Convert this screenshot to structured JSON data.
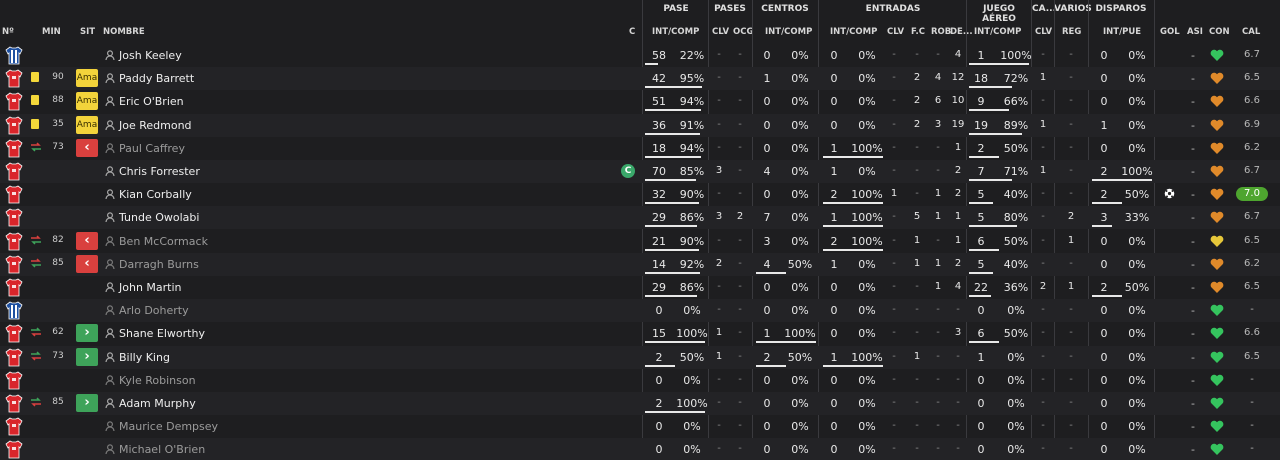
{
  "groups": {
    "pase": "PASE",
    "pases": "PASES",
    "centros": "CENTROS",
    "entradas": "ENTRADAS",
    "juego_aereo": "JUEGO AÉREO",
    "ca": "CA...",
    "varios": "VARIOS",
    "disparos": "DISPAROS"
  },
  "columns": {
    "num": "Nº",
    "min": "MIN",
    "sit": "SIT",
    "nombre": "NOMBRE",
    "c": "C",
    "pase_ic": "INT/COMP",
    "pases_clv": "CLV",
    "pases_ocg": "OCG",
    "centros_ic": "INT/COMP",
    "entradas_ic": "INT/COMP",
    "entradas_clv": "CLV",
    "entradas_fc": "F.C",
    "entradas_rob": "ROB",
    "entradas_de": "DE...",
    "aereo_ic": "INT/COMP",
    "ca_clv": "CLV",
    "varios_reg": "REG",
    "disparos_ip": "INT/PUE",
    "gol": "GOL",
    "asi": "ASI",
    "con": "CON",
    "cal": "CAL"
  },
  "captain_badge": "C",
  "colors": {
    "kit_red": "#d9252b",
    "kit_blue": "#1d4fa0",
    "card_yellow": "#f4d83a",
    "sub_out": "#d9403e",
    "sub_in": "#3ea35a",
    "heart_green": "#35c45e",
    "heart_orange": "#e08a2a",
    "heart_yellow": "#e6c73a",
    "best_rating": "#4ea52f"
  },
  "players": [
    {
      "kit": "gk",
      "evt": "",
      "min": "",
      "sit": "",
      "name": "Josh Keeley",
      "dim": false,
      "captain": false,
      "pase": [
        "58",
        "22%"
      ],
      "pase_bar": 0.22,
      "pclv": "-",
      "pocg": "-",
      "cen": [
        "0",
        "0%"
      ],
      "cen_bar": 0,
      "ent": [
        "0",
        "0%"
      ],
      "ent_bar": 0,
      "eclv": "-",
      "efc": "-",
      "erob": "-",
      "ede": "4",
      "aer": [
        "1",
        "100%"
      ],
      "aer_bar": 1,
      "caclv": "-",
      "reg": "-",
      "dis": [
        "0",
        "0%"
      ],
      "dis_bar": 0,
      "gol": "",
      "asi": "-",
      "con": "green",
      "cal": "6.7",
      "best": false
    },
    {
      "kit": "out",
      "evt": "card",
      "min": "90",
      "sit": "Ama",
      "name": "Paddy Barrett",
      "dim": false,
      "captain": false,
      "pase": [
        "42",
        "95%"
      ],
      "pase_bar": 0.95,
      "pclv": "-",
      "pocg": "-",
      "cen": [
        "1",
        "0%"
      ],
      "cen_bar": 0,
      "ent": [
        "0",
        "0%"
      ],
      "ent_bar": 0,
      "eclv": "-",
      "efc": "2",
      "erob": "4",
      "ede": "12",
      "aer": [
        "18",
        "72%"
      ],
      "aer_bar": 0.72,
      "caclv": "1",
      "reg": "-",
      "dis": [
        "0",
        "0%"
      ],
      "dis_bar": 0,
      "gol": "",
      "asi": "-",
      "con": "orange",
      "cal": "6.5",
      "best": false
    },
    {
      "kit": "out",
      "evt": "card",
      "min": "88",
      "sit": "Ama",
      "name": "Eric O'Brien",
      "dim": false,
      "captain": false,
      "pase": [
        "51",
        "94%"
      ],
      "pase_bar": 0.94,
      "pclv": "-",
      "pocg": "-",
      "cen": [
        "0",
        "0%"
      ],
      "cen_bar": 0,
      "ent": [
        "0",
        "0%"
      ],
      "ent_bar": 0,
      "eclv": "-",
      "efc": "2",
      "erob": "6",
      "ede": "10",
      "aer": [
        "9",
        "66%"
      ],
      "aer_bar": 0.66,
      "caclv": "-",
      "reg": "-",
      "dis": [
        "0",
        "0%"
      ],
      "dis_bar": 0,
      "gol": "",
      "asi": "-",
      "con": "orange",
      "cal": "6.6",
      "best": false
    },
    {
      "kit": "out",
      "evt": "card",
      "min": "35",
      "sit": "Ama",
      "name": "Joe Redmond",
      "dim": false,
      "captain": false,
      "pase": [
        "36",
        "91%"
      ],
      "pase_bar": 0.91,
      "pclv": "-",
      "pocg": "-",
      "cen": [
        "0",
        "0%"
      ],
      "cen_bar": 0,
      "ent": [
        "0",
        "0%"
      ],
      "ent_bar": 0,
      "eclv": "-",
      "efc": "2",
      "erob": "3",
      "ede": "19",
      "aer": [
        "19",
        "89%"
      ],
      "aer_bar": 0.89,
      "caclv": "1",
      "reg": "-",
      "dis": [
        "1",
        "0%"
      ],
      "dis_bar": 0,
      "gol": "",
      "asi": "-",
      "con": "orange",
      "cal": "6.9",
      "best": false
    },
    {
      "kit": "out",
      "evt": "subout",
      "min": "73",
      "sit": "out",
      "name": "Paul Caffrey",
      "dim": true,
      "captain": false,
      "pase": [
        "18",
        "94%"
      ],
      "pase_bar": 0.94,
      "pclv": "-",
      "pocg": "-",
      "cen": [
        "0",
        "0%"
      ],
      "cen_bar": 0,
      "ent": [
        "1",
        "100%"
      ],
      "ent_bar": 1,
      "eclv": "-",
      "efc": "-",
      "erob": "-",
      "ede": "1",
      "aer": [
        "2",
        "50%"
      ],
      "aer_bar": 0.5,
      "caclv": "-",
      "reg": "-",
      "dis": [
        "0",
        "0%"
      ],
      "dis_bar": 0,
      "gol": "",
      "asi": "-",
      "con": "orange",
      "cal": "6.2",
      "best": false
    },
    {
      "kit": "out",
      "evt": "",
      "min": "",
      "sit": "",
      "name": "Chris Forrester",
      "dim": false,
      "captain": true,
      "pase": [
        "70",
        "85%"
      ],
      "pase_bar": 0.85,
      "pclv": "3",
      "pocg": "-",
      "cen": [
        "4",
        "0%"
      ],
      "cen_bar": 0,
      "ent": [
        "1",
        "0%"
      ],
      "ent_bar": 0,
      "eclv": "-",
      "efc": "-",
      "erob": "-",
      "ede": "2",
      "aer": [
        "7",
        "71%"
      ],
      "aer_bar": 0.71,
      "caclv": "1",
      "reg": "-",
      "dis": [
        "2",
        "100%"
      ],
      "dis_bar": 1,
      "gol": "",
      "asi": "-",
      "con": "orange",
      "cal": "6.7",
      "best": false
    },
    {
      "kit": "out",
      "evt": "",
      "min": "",
      "sit": "",
      "name": "Kian Corbally",
      "dim": false,
      "captain": false,
      "pase": [
        "32",
        "90%"
      ],
      "pase_bar": 0.9,
      "pclv": "-",
      "pocg": "-",
      "cen": [
        "0",
        "0%"
      ],
      "cen_bar": 0,
      "ent": [
        "2",
        "100%"
      ],
      "ent_bar": 1,
      "eclv": "1",
      "efc": "-",
      "erob": "1",
      "ede": "2",
      "aer": [
        "5",
        "40%"
      ],
      "aer_bar": 0.4,
      "caclv": "-",
      "reg": "-",
      "dis": [
        "2",
        "50%"
      ],
      "dis_bar": 0.5,
      "gol": "ball",
      "asi": "-",
      "con": "orange",
      "cal": "7.0",
      "best": true
    },
    {
      "kit": "out",
      "evt": "",
      "min": "",
      "sit": "",
      "name": "Tunde Owolabi",
      "dim": false,
      "captain": false,
      "pase": [
        "29",
        "86%"
      ],
      "pase_bar": 0.86,
      "pclv": "3",
      "pocg": "2",
      "cen": [
        "7",
        "0%"
      ],
      "cen_bar": 0,
      "ent": [
        "1",
        "100%"
      ],
      "ent_bar": 1,
      "eclv": "-",
      "efc": "5",
      "erob": "1",
      "ede": "1",
      "aer": [
        "5",
        "80%"
      ],
      "aer_bar": 0.8,
      "caclv": "-",
      "reg": "2",
      "dis": [
        "3",
        "33%"
      ],
      "dis_bar": 0.33,
      "gol": "",
      "asi": "-",
      "con": "orange",
      "cal": "6.7",
      "best": false
    },
    {
      "kit": "out",
      "evt": "subout",
      "min": "82",
      "sit": "out",
      "name": "Ben McCormack",
      "dim": true,
      "captain": false,
      "pase": [
        "21",
        "90%"
      ],
      "pase_bar": 0.9,
      "pclv": "-",
      "pocg": "-",
      "cen": [
        "3",
        "0%"
      ],
      "cen_bar": 0,
      "ent": [
        "2",
        "100%"
      ],
      "ent_bar": 1,
      "eclv": "-",
      "efc": "1",
      "erob": "-",
      "ede": "1",
      "aer": [
        "6",
        "50%"
      ],
      "aer_bar": 0.5,
      "caclv": "-",
      "reg": "1",
      "dis": [
        "0",
        "0%"
      ],
      "dis_bar": 0,
      "gol": "",
      "asi": "-",
      "con": "yellow",
      "cal": "6.5",
      "best": false
    },
    {
      "kit": "out",
      "evt": "subout",
      "min": "85",
      "sit": "out",
      "name": "Darragh Burns",
      "dim": true,
      "captain": false,
      "pase": [
        "14",
        "92%"
      ],
      "pase_bar": 0.92,
      "pclv": "2",
      "pocg": "-",
      "cen": [
        "4",
        "50%"
      ],
      "cen_bar": 0.5,
      "ent": [
        "1",
        "0%"
      ],
      "ent_bar": 0,
      "eclv": "-",
      "efc": "1",
      "erob": "1",
      "ede": "2",
      "aer": [
        "5",
        "40%"
      ],
      "aer_bar": 0.4,
      "caclv": "-",
      "reg": "-",
      "dis": [
        "0",
        "0%"
      ],
      "dis_bar": 0,
      "gol": "",
      "asi": "-",
      "con": "orange",
      "cal": "6.2",
      "best": false
    },
    {
      "kit": "out",
      "evt": "",
      "min": "",
      "sit": "",
      "name": "John Martin",
      "dim": false,
      "captain": false,
      "pase": [
        "29",
        "86%"
      ],
      "pase_bar": 0.86,
      "pclv": "-",
      "pocg": "-",
      "cen": [
        "0",
        "0%"
      ],
      "cen_bar": 0,
      "ent": [
        "0",
        "0%"
      ],
      "ent_bar": 0,
      "eclv": "-",
      "efc": "-",
      "erob": "1",
      "ede": "4",
      "aer": [
        "22",
        "36%"
      ],
      "aer_bar": 0.36,
      "caclv": "2",
      "reg": "1",
      "dis": [
        "2",
        "50%"
      ],
      "dis_bar": 0.5,
      "gol": "",
      "asi": "-",
      "con": "orange",
      "cal": "6.5",
      "best": false
    },
    {
      "kit": "gk",
      "evt": "",
      "min": "",
      "sit": "",
      "name": "Arlo Doherty",
      "dim": true,
      "captain": false,
      "pase": [
        "0",
        "0%"
      ],
      "pase_bar": 0,
      "pclv": "-",
      "pocg": "-",
      "cen": [
        "0",
        "0%"
      ],
      "cen_bar": 0,
      "ent": [
        "0",
        "0%"
      ],
      "ent_bar": 0,
      "eclv": "-",
      "efc": "-",
      "erob": "-",
      "ede": "-",
      "aer": [
        "0",
        "0%"
      ],
      "aer_bar": 0,
      "caclv": "-",
      "reg": "-",
      "dis": [
        "0",
        "0%"
      ],
      "dis_bar": 0,
      "gol": "",
      "asi": "-",
      "con": "green",
      "cal": "-",
      "best": false
    },
    {
      "kit": "out",
      "evt": "subin",
      "min": "62",
      "sit": "in",
      "name": "Shane Elworthy",
      "dim": false,
      "captain": false,
      "pase": [
        "15",
        "100%"
      ],
      "pase_bar": 1,
      "pclv": "1",
      "pocg": "-",
      "cen": [
        "1",
        "100%"
      ],
      "cen_bar": 1,
      "ent": [
        "0",
        "0%"
      ],
      "ent_bar": 0,
      "eclv": "-",
      "efc": "-",
      "erob": "-",
      "ede": "3",
      "aer": [
        "6",
        "50%"
      ],
      "aer_bar": 0.5,
      "caclv": "-",
      "reg": "-",
      "dis": [
        "0",
        "0%"
      ],
      "dis_bar": 0,
      "gol": "",
      "asi": "-",
      "con": "green",
      "cal": "6.6",
      "best": false
    },
    {
      "kit": "out",
      "evt": "subin",
      "min": "73",
      "sit": "in",
      "name": "Billy King",
      "dim": false,
      "captain": false,
      "pase": [
        "2",
        "50%"
      ],
      "pase_bar": 0.5,
      "pclv": "1",
      "pocg": "-",
      "cen": [
        "2",
        "50%"
      ],
      "cen_bar": 0.5,
      "ent": [
        "1",
        "100%"
      ],
      "ent_bar": 1,
      "eclv": "-",
      "efc": "1",
      "erob": "-",
      "ede": "-",
      "aer": [
        "1",
        "0%"
      ],
      "aer_bar": 0,
      "caclv": "-",
      "reg": "-",
      "dis": [
        "0",
        "0%"
      ],
      "dis_bar": 0,
      "gol": "",
      "asi": "-",
      "con": "green",
      "cal": "6.5",
      "best": false
    },
    {
      "kit": "out",
      "evt": "",
      "min": "",
      "sit": "",
      "name": "Kyle Robinson",
      "dim": true,
      "captain": false,
      "pase": [
        "0",
        "0%"
      ],
      "pase_bar": 0,
      "pclv": "-",
      "pocg": "-",
      "cen": [
        "0",
        "0%"
      ],
      "cen_bar": 0,
      "ent": [
        "0",
        "0%"
      ],
      "ent_bar": 0,
      "eclv": "-",
      "efc": "-",
      "erob": "-",
      "ede": "-",
      "aer": [
        "0",
        "0%"
      ],
      "aer_bar": 0,
      "caclv": "-",
      "reg": "-",
      "dis": [
        "0",
        "0%"
      ],
      "dis_bar": 0,
      "gol": "",
      "asi": "-",
      "con": "green",
      "cal": "-",
      "best": false
    },
    {
      "kit": "out",
      "evt": "subin",
      "min": "85",
      "sit": "in",
      "name": "Adam Murphy",
      "dim": false,
      "captain": false,
      "pase": [
        "2",
        "100%"
      ],
      "pase_bar": 1,
      "pclv": "-",
      "pocg": "-",
      "cen": [
        "0",
        "0%"
      ],
      "cen_bar": 0,
      "ent": [
        "0",
        "0%"
      ],
      "ent_bar": 0,
      "eclv": "-",
      "efc": "-",
      "erob": "-",
      "ede": "-",
      "aer": [
        "0",
        "0%"
      ],
      "aer_bar": 0,
      "caclv": "-",
      "reg": "-",
      "dis": [
        "0",
        "0%"
      ],
      "dis_bar": 0,
      "gol": "",
      "asi": "-",
      "con": "green",
      "cal": "-",
      "best": false
    },
    {
      "kit": "out",
      "evt": "",
      "min": "",
      "sit": "",
      "name": "Maurice Dempsey",
      "dim": true,
      "captain": false,
      "pase": [
        "0",
        "0%"
      ],
      "pase_bar": 0,
      "pclv": "-",
      "pocg": "-",
      "cen": [
        "0",
        "0%"
      ],
      "cen_bar": 0,
      "ent": [
        "0",
        "0%"
      ],
      "ent_bar": 0,
      "eclv": "-",
      "efc": "-",
      "erob": "-",
      "ede": "-",
      "aer": [
        "0",
        "0%"
      ],
      "aer_bar": 0,
      "caclv": "-",
      "reg": "-",
      "dis": [
        "0",
        "0%"
      ],
      "dis_bar": 0,
      "gol": "",
      "asi": "-",
      "con": "green",
      "cal": "-",
      "best": false
    },
    {
      "kit": "out",
      "evt": "",
      "min": "",
      "sit": "",
      "name": "Michael O'Brien",
      "dim": true,
      "captain": false,
      "pase": [
        "0",
        "0%"
      ],
      "pase_bar": 0,
      "pclv": "-",
      "pocg": "-",
      "cen": [
        "0",
        "0%"
      ],
      "cen_bar": 0,
      "ent": [
        "0",
        "0%"
      ],
      "ent_bar": 0,
      "eclv": "-",
      "efc": "-",
      "erob": "-",
      "ede": "-",
      "aer": [
        "0",
        "0%"
      ],
      "aer_bar": 0,
      "caclv": "-",
      "reg": "-",
      "dis": [
        "0",
        "0%"
      ],
      "dis_bar": 0,
      "gol": "",
      "asi": "-",
      "con": "green",
      "cal": "-",
      "best": false
    }
  ]
}
